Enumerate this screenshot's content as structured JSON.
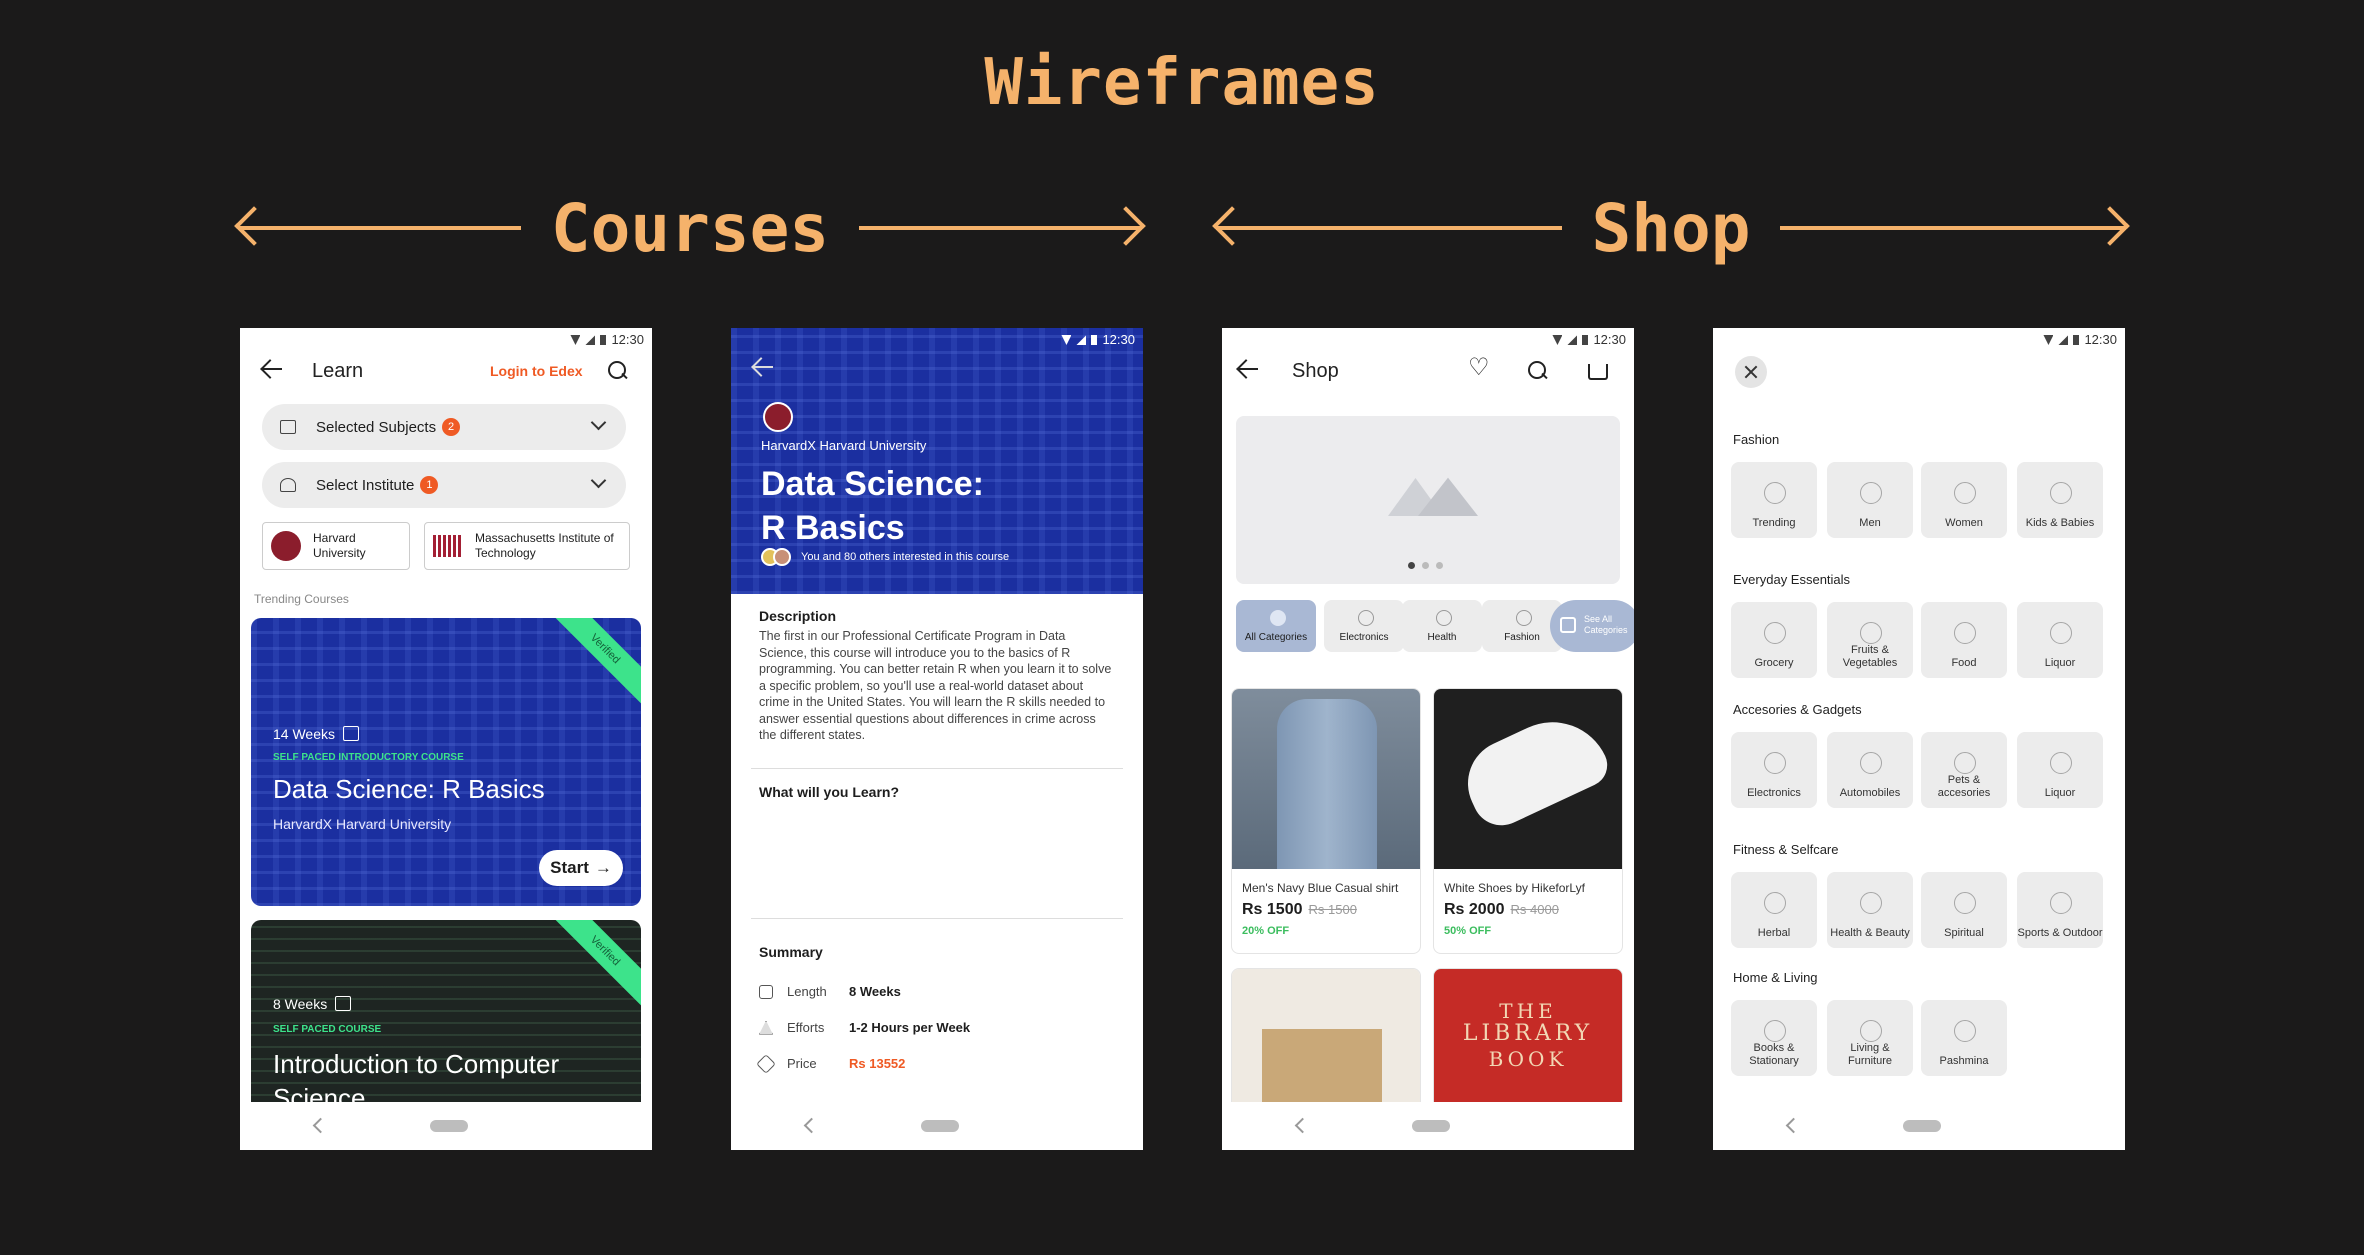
{
  "title": "Wireframes",
  "sections": {
    "courses": "Courses",
    "shop": "Shop"
  },
  "status_time": "12:30",
  "learn": {
    "title": "Learn",
    "login": "Login to Edex",
    "subjects": {
      "label": "Selected Subjects",
      "badge": "2"
    },
    "institute": {
      "label": "Select Institute",
      "badge": "1"
    },
    "institutions": [
      "Harvard University",
      "Massachusetts Institute of Technology"
    ],
    "trending_label": "Trending Courses",
    "courses": [
      {
        "weeks": "14 Weeks",
        "tag": "SELF PACED INTRODUCTORY COURSE",
        "title": "Data Science: R Basics",
        "institution": "HarvardX Harvard University",
        "badge": "Verified",
        "cta": "Start"
      },
      {
        "weeks": "8 Weeks",
        "tag": "SELF PACED COURSE",
        "title": "Introduction to Computer Science",
        "badge": "Verified"
      }
    ]
  },
  "detail": {
    "institution": "HarvardX Harvard University",
    "title_line1": "Data Science:",
    "title_line2": "R Basics",
    "interested": "You and 80 others interested in this course",
    "description_heading": "Description",
    "description": "The first in our Professional Certificate Program in Data Science, this course will introduce you to the basics of R programming. You can better retain R when you learn it to solve a specific problem, so you'll use a real-world dataset about crime in the United States. You will learn the R skills needed to answer essential questions about differences in crime across the different states.",
    "learn_heading": "What will you Learn?",
    "summary_heading": "Summary",
    "summary": [
      {
        "key": "Length",
        "value": "8 Weeks"
      },
      {
        "key": "Efforts",
        "value": "1-2 Hours per Week"
      },
      {
        "key": "Price",
        "value": "Rs 13552"
      }
    ]
  },
  "shop": {
    "title": "Shop",
    "categories": [
      "All Categories",
      "Electronics",
      "Health",
      "Fashion"
    ],
    "see_all": "See All Categories",
    "products": [
      {
        "name": "Men's Navy Blue Casual shirt",
        "price": "Rs 1500",
        "old_price": "Rs 1500",
        "off": "20% OFF"
      },
      {
        "name": "White Shoes by HikeforLyf",
        "price": "Rs 2000",
        "old_price": "Rs 4000",
        "off": "50% OFF"
      }
    ],
    "book_text": [
      "THE",
      "LIBRARY",
      "BOOK"
    ]
  },
  "catalog": {
    "sections": [
      {
        "title": "Fashion",
        "items": [
          "Trending",
          "Men",
          "Women",
          "Kids & Babies"
        ]
      },
      {
        "title": "Everyday Essentials",
        "items": [
          "Grocery",
          "Fruits & Vegetables",
          "Food",
          "Liquor"
        ]
      },
      {
        "title": "Accesories & Gadgets",
        "items": [
          "Electronics",
          "Automobiles",
          "Pets & accesories",
          "Liquor"
        ]
      },
      {
        "title": "Fitness & Selfcare",
        "items": [
          "Herbal",
          "Health & Beauty",
          "Spiritual",
          "Sports & Outdoor"
        ]
      },
      {
        "title": "Home & Living",
        "items": [
          "Books & Stationary",
          "Living & Furniture",
          "Pashmina"
        ]
      }
    ]
  }
}
